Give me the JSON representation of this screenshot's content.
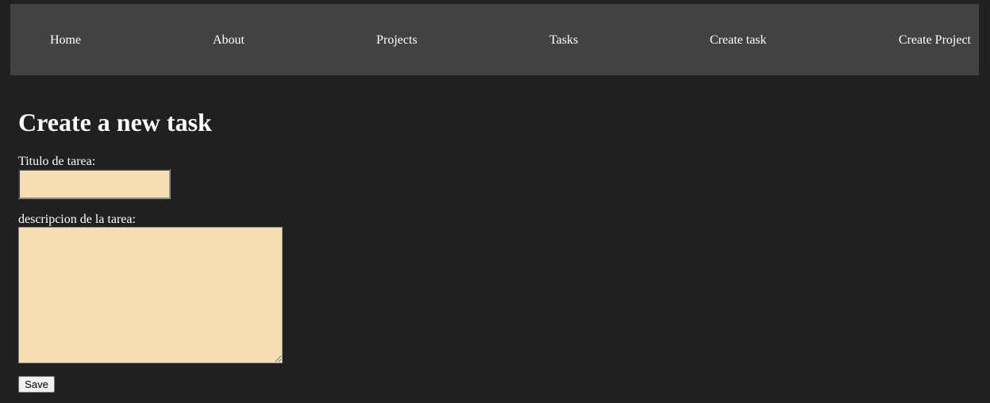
{
  "colors": {
    "page_background": "#202020",
    "navbar_background": "#424242",
    "text": "#ffffff",
    "input_background": "#f5deb3"
  },
  "navbar": {
    "items": [
      {
        "label": "Home"
      },
      {
        "label": "About"
      },
      {
        "label": "Projects"
      },
      {
        "label": "Tasks"
      },
      {
        "label": "Create task"
      },
      {
        "label": "Create Project"
      }
    ]
  },
  "main": {
    "heading": "Create a new task",
    "form": {
      "title_label": "Titulo de tarea:",
      "title_value": "",
      "description_label": "descripcion de la tarea:",
      "description_value": "",
      "save_label": "Save"
    }
  }
}
